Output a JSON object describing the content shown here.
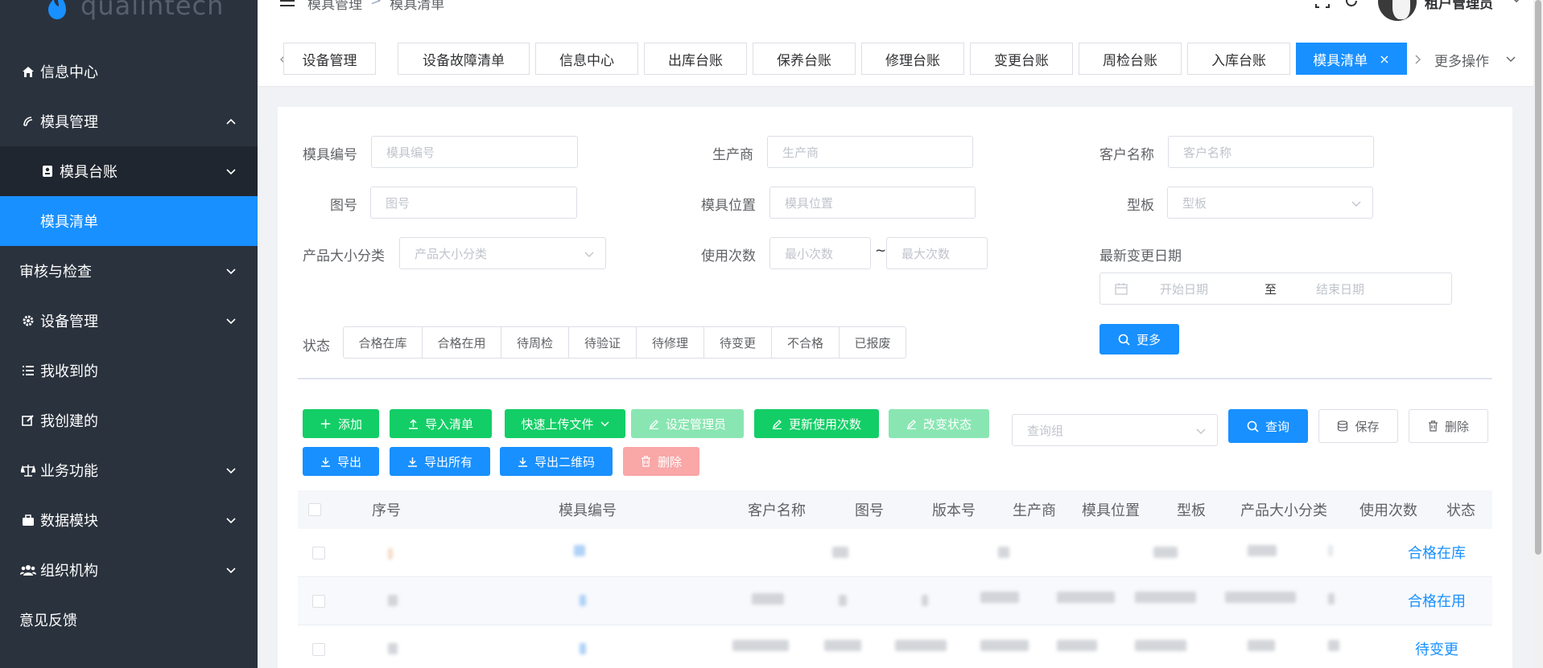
{
  "sidebar": {
    "logo_text": "qualintech",
    "items": [
      {
        "label": "信息中心",
        "icon": "home-icon"
      },
      {
        "label": "模具管理",
        "icon": "mold-icon"
      },
      {
        "label": "模具台账",
        "icon": "ledger-icon"
      },
      {
        "label": "模具清单",
        "icon": ""
      },
      {
        "label": "审核与检查",
        "icon": ""
      },
      {
        "label": "设备管理",
        "icon": "gear-icon"
      },
      {
        "label": "我收到的",
        "icon": "list-icon"
      },
      {
        "label": "我创建的",
        "icon": "edit-icon"
      },
      {
        "label": "业务功能",
        "icon": "scale-icon"
      },
      {
        "label": "数据模块",
        "icon": "briefcase-icon"
      },
      {
        "label": "组织机构",
        "icon": "users-icon"
      },
      {
        "label": "意见反馈",
        "icon": ""
      }
    ]
  },
  "header": {
    "breadcrumb": [
      "模具管理",
      "模具清单"
    ],
    "breadcrumb_sep": ">",
    "user_name": "租户管理员"
  },
  "tabs": {
    "items": [
      "设备管理",
      "设备故障清单",
      "信息中心",
      "出库台账",
      "保养台账",
      "修理台账",
      "变更台账",
      "周检台账",
      "入库台账",
      "模具清单"
    ],
    "active_close": "×",
    "more_label": "更多操作"
  },
  "filters": {
    "mold_no": {
      "label": "模具编号",
      "placeholder": "模具编号"
    },
    "manufacturer": {
      "label": "生产商",
      "placeholder": "生产商"
    },
    "customer": {
      "label": "客户名称",
      "placeholder": "客户名称"
    },
    "drawing_no": {
      "label": "图号",
      "placeholder": "图号"
    },
    "location": {
      "label": "模具位置",
      "placeholder": "模具位置"
    },
    "template": {
      "label": "型板",
      "placeholder": "型板"
    },
    "category": {
      "label": "产品大小分类",
      "placeholder": "产品大小分类"
    },
    "usage": {
      "label": "使用次数",
      "min_placeholder": "最小次数",
      "sep": "~",
      "max_placeholder": "最大次数"
    },
    "date": {
      "label": "最新变更日期",
      "start_placeholder": "开始日期",
      "sep": "至",
      "end_placeholder": "结束日期"
    },
    "more_button": "更多",
    "status_label": "状态",
    "status_options": [
      "合格在库",
      "合格在用",
      "待周检",
      "待验证",
      "待修理",
      "待变更",
      "不合格",
      "已报废"
    ]
  },
  "toolbar": {
    "add": "添加",
    "import_list": "导入清单",
    "quick_upload": "快速上传文件",
    "set_manager": "设定管理员",
    "update_usage": "更新使用次数",
    "change_status": "改变状态",
    "export": "导出",
    "export_all": "导出所有",
    "export_qr": "导出二维码",
    "delete": "删除",
    "query_group_placeholder": "查询组",
    "query": "查询",
    "save": "保存",
    "delete_group": "删除"
  },
  "table": {
    "columns": [
      "序号",
      "模具编号",
      "客户名称",
      "图号",
      "版本号",
      "生产商",
      "模具位置",
      "型板",
      "产品大小分类",
      "使用次数",
      "状态"
    ],
    "rows": [
      {
        "status": "合格在库"
      },
      {
        "status": "合格在用"
      },
      {
        "status": "待变更"
      }
    ]
  },
  "colors": {
    "sidebar_bg": "#2a323d",
    "accent": "#1890ff",
    "success": "#13ce66",
    "danger_disabled": "#f9a7a7"
  }
}
